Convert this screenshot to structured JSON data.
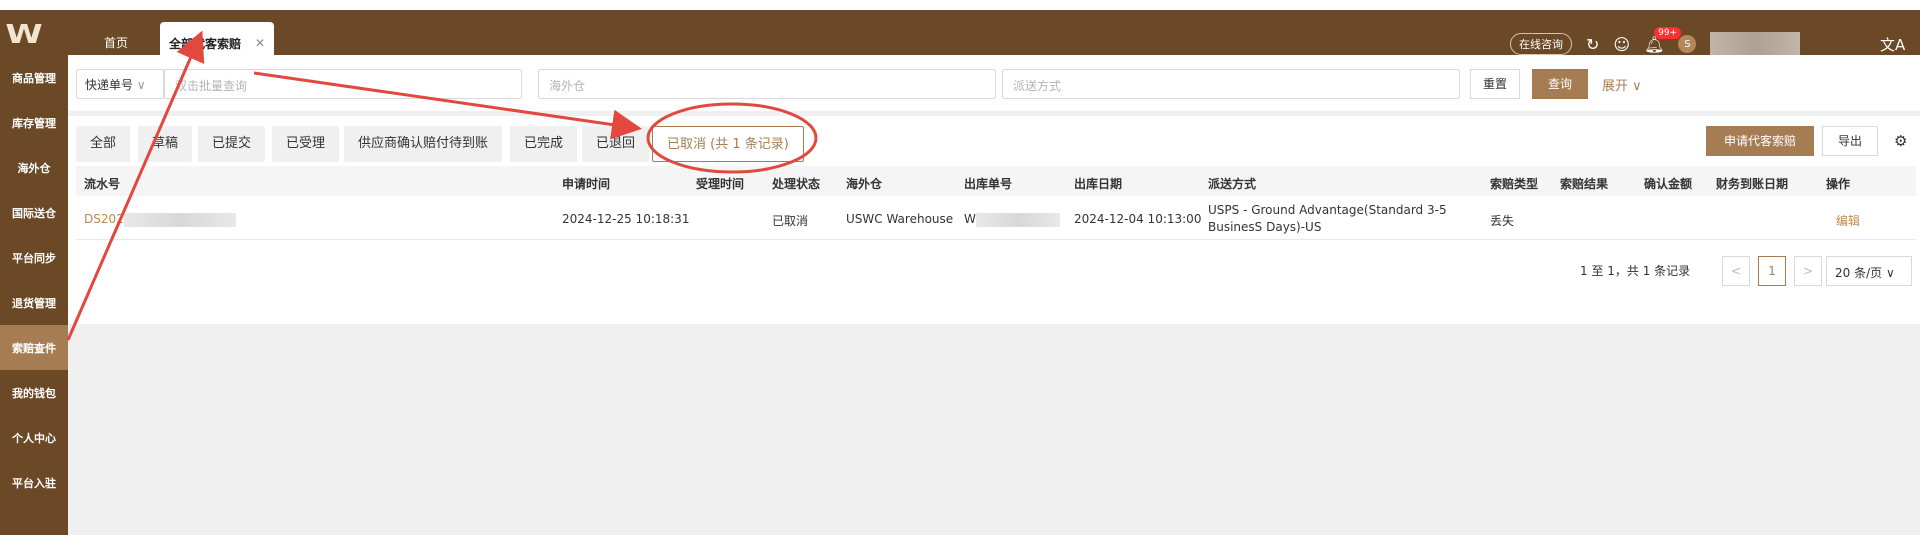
{
  "topbar": {
    "logo": "W",
    "tab_home": "首页",
    "tab_active": "全部代客索赔",
    "tab_close": "✕",
    "consult": "在线咨询",
    "badge": "99+",
    "avatar": "S",
    "lang": "文A"
  },
  "sidebar": [
    "商品管理",
    "库存管理",
    "海外仓",
    "国际送仓",
    "平台同步",
    "退货管理",
    "索赔查件",
    "我的钱包",
    "个人中心",
    "平台入驻"
  ],
  "filter": {
    "select": "快递单号",
    "select_arrow": "∨",
    "input1": "双击批量查询",
    "input2": "海外仓",
    "input3": "派送方式",
    "reset": "重置",
    "query": "查询",
    "expand": "展开 ∨"
  },
  "tabs": [
    "全部",
    "草稿",
    "已提交",
    "已受理",
    "供应商确认赔付待到账",
    "已完成",
    "已退回",
    "已取消 (共 1 条记录)"
  ],
  "actions": {
    "apply": "申请代客索赔",
    "export": "导出",
    "gear": "⚙"
  },
  "table": {
    "headers": [
      "流水号",
      "申请时间",
      "受理时间",
      "处理状态",
      "海外仓",
      "出库单号",
      "出库日期",
      "派送方式",
      "索赔类型",
      "索赔结果",
      "确认金额",
      "财务到账日期",
      "操作"
    ],
    "row": {
      "serial": "DS202",
      "apply_time": "2024-12-25 10:18:31",
      "status": "已取消",
      "warehouse": "USWC Warehouse",
      "out_no": "W",
      "out_date": "2024-12-04 10:13:00",
      "ship1": "USPS - Ground Advantage(Standard 3-5",
      "ship2": "BusinesS Days)-US",
      "claim_type": "丢失",
      "op": "编辑"
    }
  },
  "pager": {
    "summary": "1 至 1，共 1 条记录",
    "prev": "<",
    "page": "1",
    "next": ">",
    "size": "20 条/页 ∨"
  }
}
